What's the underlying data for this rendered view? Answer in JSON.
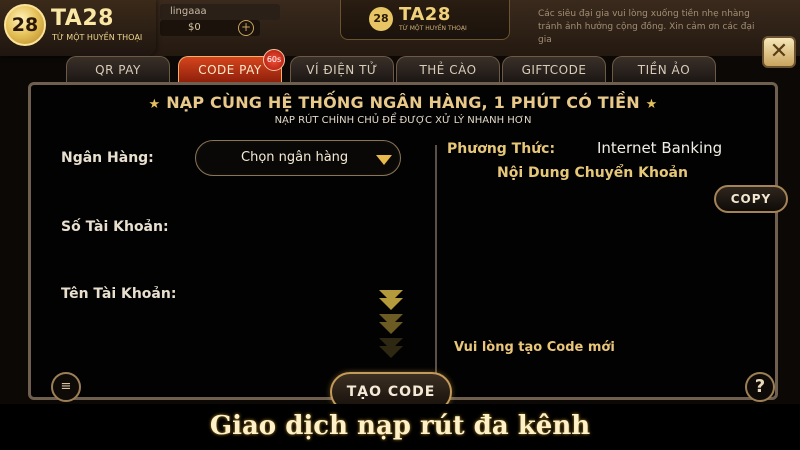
{
  "brand": {
    "logo_mark": "28",
    "name": "TA28",
    "tagline": "TỪ MỘT HUYỀN THOẠI"
  },
  "header": {
    "username": "lingaaa",
    "balance": "$0",
    "add_label": "+",
    "center_logo_mark": "28",
    "center_logo_name": "TA28",
    "center_logo_tagline": "TỪ MỘT HUYỀN THOẠI",
    "notice": "Các siêu đại gia vui lòng xuống tiền nhẹ nhàng tránh ảnh hưởng cộng đồng. Xin cảm ơn các đại gia"
  },
  "close_label": "✕",
  "tabs": [
    {
      "label": "QR PAY",
      "active": false
    },
    {
      "label": "CODE PAY",
      "active": true
    },
    {
      "label": "VÍ ĐIỆN TỬ",
      "active": false
    },
    {
      "label": "THẺ CÀO",
      "active": false
    },
    {
      "label": "GIFTCODE",
      "active": false
    },
    {
      "label": "TIỀN ẢO",
      "active": false
    }
  ],
  "tab_badge": "60s",
  "panel": {
    "title": "NẠP CÙNG HỆ THỐNG NGÂN HÀNG, 1 PHÚT CÓ TIỀN",
    "title_star": "★",
    "subtitle": "NẠP RÚT CHÍNH CHỦ ĐỂ ĐƯỢC XỬ LÝ NHANH HƠN",
    "bank_label": "Ngân Hàng:",
    "bank_select_text": "Chọn ngân hàng",
    "account_number_label": "Số Tài Khoản:",
    "account_name_label": "Tên Tài Khoản:",
    "method_label": "Phương Thức:",
    "method_value": "Internet Banking",
    "transfer_content_label": "Nội Dung Chuyển Khoản",
    "copy_label": "COPY",
    "new_code_hint": "Vui lòng tạo Code mới",
    "create_code_label": "TẠO CODE",
    "help_label": "?",
    "doc_label": "≡"
  },
  "caption": "Giao dịch nạp rút đa kênh",
  "colors": {
    "accent_gold": "#e6c777",
    "active_tab": "#c73a17",
    "panel_border": "#6f5f4f"
  }
}
